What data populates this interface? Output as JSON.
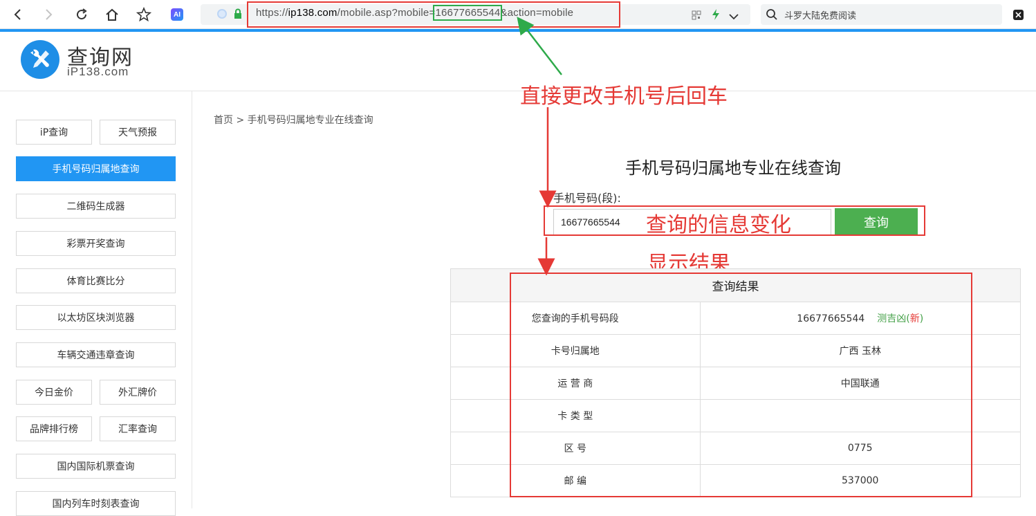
{
  "browser": {
    "url_prefix": "https://",
    "url_domain": "ip138.com",
    "url_path": "/mobile.asp?mobile=",
    "url_number": "16677665544",
    "url_suffix": "&action=mobile",
    "search_text": "斗罗大陆免费阅读",
    "ai_label": "AI"
  },
  "site": {
    "logo_title": "查询网",
    "logo_sub": "iP138.com"
  },
  "sidebar": {
    "items": [
      "iP查询",
      "天气预报",
      "手机号码归属地查询",
      "二维码生成器",
      "彩票开奖查询",
      "体育比赛比分",
      "以太坊区块浏览器",
      "车辆交通违章查询",
      "今日金价",
      "外汇牌价",
      "品牌排行榜",
      "汇率查询",
      "国内国际机票查询",
      "国内列车时刻表查询"
    ]
  },
  "main": {
    "breadcrumb": "首页 > 手机号码归属地专业在线查询",
    "title": "手机号码归属地专业在线查询",
    "field_label": "手机号码(段):",
    "input_value": "16677665544",
    "query_button": "查询"
  },
  "annotations": {
    "change_number": "直接更改手机号后回车",
    "info_change": "查询的信息变化",
    "show_result": "显示结果"
  },
  "result": {
    "header": "查询结果",
    "rows": [
      {
        "key": "您查询的手机号码段",
        "value": "16677665544"
      },
      {
        "key": "卡号归属地",
        "value": "广西 玉林"
      },
      {
        "key": "运 营 商",
        "value": "中国联通"
      },
      {
        "key": "卡 类 型",
        "value": ""
      },
      {
        "key": "区 号",
        "value": "0775"
      },
      {
        "key": "邮 编",
        "value": "537000"
      }
    ],
    "luck_text": "测吉凶(",
    "luck_new": "新",
    "luck_close": ")"
  },
  "colors": {
    "accent_blue": "#2196f3",
    "query_green": "#4caf50",
    "annotation_red": "#e53935",
    "url_highlight_green": "#2eaa4a"
  }
}
